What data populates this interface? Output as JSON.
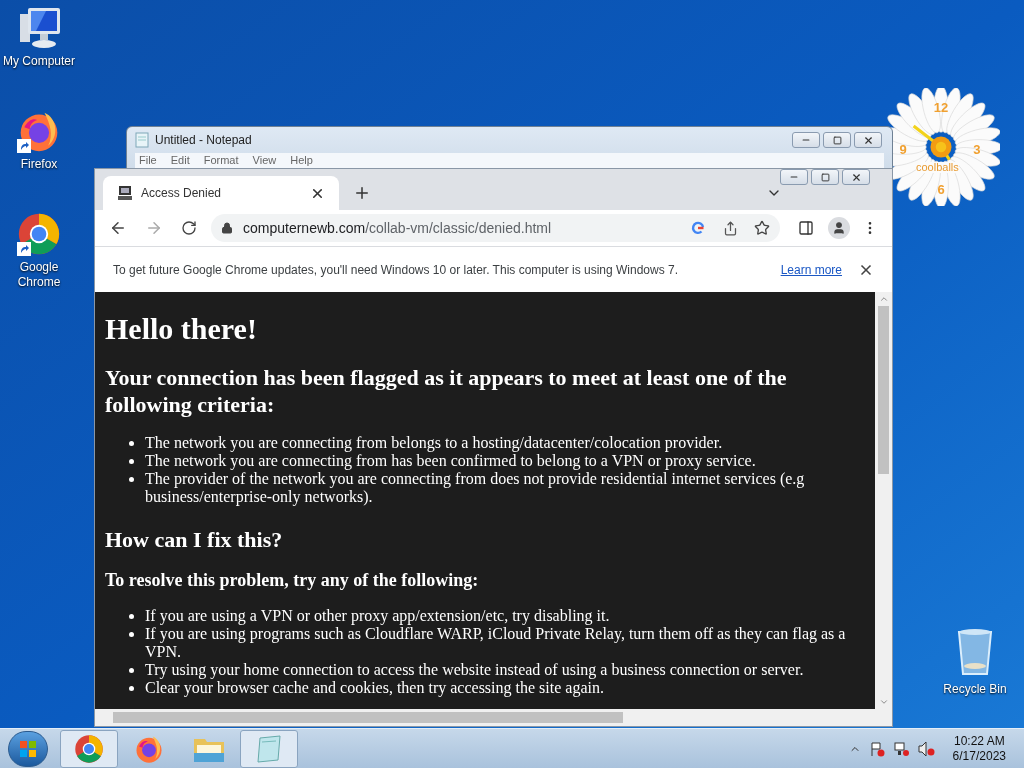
{
  "desktop_icons": [
    {
      "label": "My Computer",
      "kind": "computer",
      "shortcut": false
    },
    {
      "label": "Firefox",
      "kind": "firefox",
      "shortcut": true
    },
    {
      "label": "Google Chrome",
      "kind": "chrome",
      "shortcut": true
    }
  ],
  "recycle_bin": {
    "label": "Recycle Bin"
  },
  "clock_gadget": {
    "numerals": [
      "12",
      "3",
      "6",
      "9"
    ],
    "caption": "coolballs"
  },
  "notepad": {
    "title": "Untitled - Notepad",
    "menu": [
      "File",
      "Edit",
      "Format",
      "View",
      "Help"
    ]
  },
  "browser": {
    "tabs": [
      {
        "title": "Access Denied",
        "selected": true
      }
    ],
    "url_host": "computernewb.com",
    "url_path": "/collab-vm/classic/denied.html",
    "infobar": {
      "message": "To get future Google Chrome updates, you'll need Windows 10 or later. This computer is using Windows 7.",
      "link": "Learn more"
    },
    "page": {
      "title": "Hello there!",
      "blocks": [
        {
          "kind": "h2",
          "text": "Your connection has been flagged as it appears to meet at least one of the following criteria:"
        },
        {
          "kind": "list",
          "items": [
            "The network you are connecting from belongs to a hosting/datacenter/colocation provider.",
            "The network you are connecting from has been confirmed to belong to a VPN or proxy service.",
            "The provider of the network you are connecting from does not provide residential internet services (e.g business/enterprise-only networks)."
          ]
        },
        {
          "kind": "h2",
          "text": "How can I fix this?"
        },
        {
          "kind": "h3",
          "text": "To resolve this problem, try any of the following:"
        },
        {
          "kind": "list",
          "items": [
            "If you are using a VPN or other proxy app/extension/etc, try disabling it.",
            "If you are using programs such as Cloudflare WARP, iCloud Private Relay, turn them off as they can flag as a VPN.",
            "Try using your home connection to access the website instead of using a business connection or server.",
            "Clear your browser cache and cookies, then try accessing the site again."
          ]
        }
      ]
    }
  },
  "taskbar": {
    "items": [
      {
        "kind": "chrome",
        "selected": true
      },
      {
        "kind": "firefox",
        "selected": false
      },
      {
        "kind": "explorer",
        "selected": false
      },
      {
        "kind": "notepad",
        "selected": true
      }
    ],
    "time": "10:22 AM",
    "date": "6/17/2023"
  }
}
